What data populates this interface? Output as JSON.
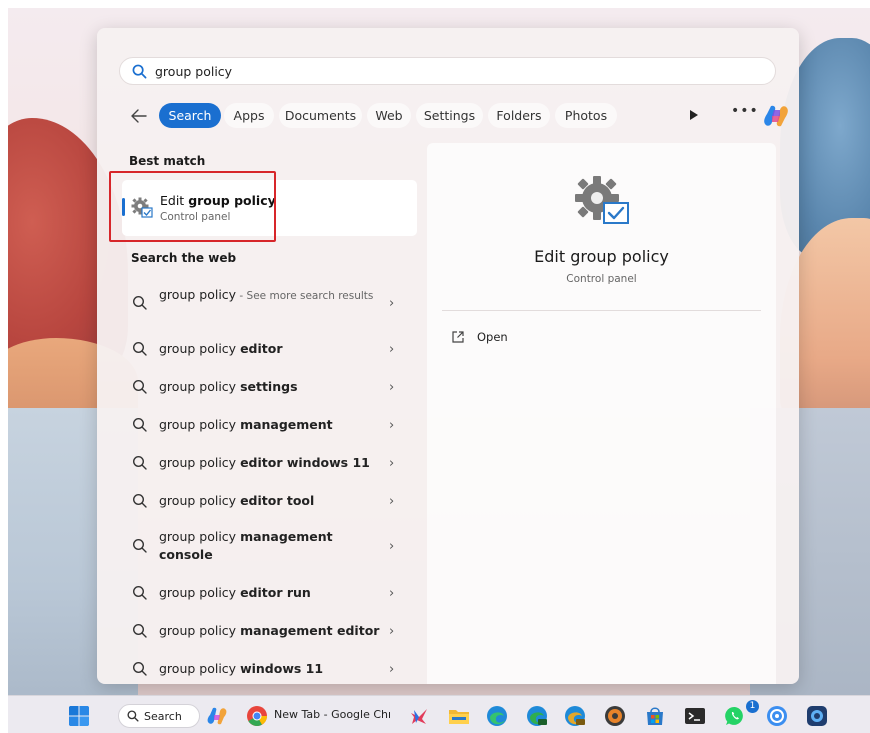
{
  "search": {
    "query": "group policy"
  },
  "filters": {
    "items": [
      "Search",
      "Apps",
      "Documents",
      "Web",
      "Settings",
      "Folders",
      "Photos"
    ],
    "active": "Search"
  },
  "best_match": {
    "section_label": "Best match",
    "title_prefix": "Edit ",
    "title_bold": "group policy",
    "subtitle": "Control panel"
  },
  "web": {
    "section_label": "Search the web",
    "items": [
      {
        "prefix": "group policy",
        "bold": "",
        "suffix": " - See more search results"
      },
      {
        "prefix": "group policy ",
        "bold": "editor",
        "suffix": ""
      },
      {
        "prefix": "group policy ",
        "bold": "settings",
        "suffix": ""
      },
      {
        "prefix": "group policy ",
        "bold": "management",
        "suffix": ""
      },
      {
        "prefix": "group policy ",
        "bold": "editor windows 11",
        "suffix": ""
      },
      {
        "prefix": "group policy ",
        "bold": "editor tool",
        "suffix": ""
      },
      {
        "prefix": "group policy ",
        "bold": "management console",
        "suffix": ""
      },
      {
        "prefix": "group policy ",
        "bold": "editor run",
        "suffix": ""
      },
      {
        "prefix": "group policy ",
        "bold": "management editor",
        "suffix": ""
      },
      {
        "prefix": "group policy ",
        "bold": "windows 11",
        "suffix": ""
      }
    ]
  },
  "detail": {
    "title": "Edit group policy",
    "subtitle": "Control panel",
    "open_label": "Open"
  },
  "taskbar": {
    "search_label": "Search",
    "chrome_label": "New Tab - Google Chrome",
    "whatsapp_badge": "1"
  },
  "colors": {
    "accent": "#1a6fd0",
    "highlight_box": "#d7262a"
  }
}
